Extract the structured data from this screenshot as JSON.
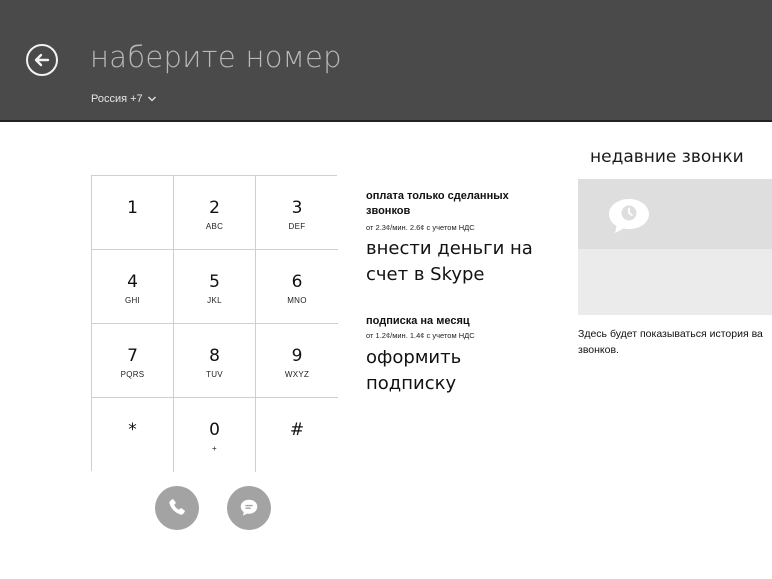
{
  "header": {
    "title": "наберите номер",
    "country": "Россия +7"
  },
  "keypad": [
    {
      "digit": "1",
      "letters": ""
    },
    {
      "digit": "2",
      "letters": "ABC"
    },
    {
      "digit": "3",
      "letters": "DEF"
    },
    {
      "digit": "4",
      "letters": "GHI"
    },
    {
      "digit": "5",
      "letters": "JKL"
    },
    {
      "digit": "6",
      "letters": "MNO"
    },
    {
      "digit": "7",
      "letters": "PQRS"
    },
    {
      "digit": "8",
      "letters": "TUV"
    },
    {
      "digit": "9",
      "letters": "WXYZ"
    },
    {
      "digit": "*",
      "letters": ""
    },
    {
      "digit": "0",
      "letters": "+"
    },
    {
      "digit": "#",
      "letters": ""
    }
  ],
  "offers": {
    "payg": {
      "title": "оплата только сделанных звонков",
      "price": "от 2.3¢/мин. 2.6¢ с учетом НДС",
      "action": "внести деньги на счет в Skype"
    },
    "subscription": {
      "title": "подписка на месяц",
      "price": "от 1.2¢/мин. 1.4¢ с учетом НДС",
      "action": "оформить подписку"
    }
  },
  "recent": {
    "title": "недавние звонки",
    "empty_text": "Здесь будет показываться история ва звонков."
  }
}
